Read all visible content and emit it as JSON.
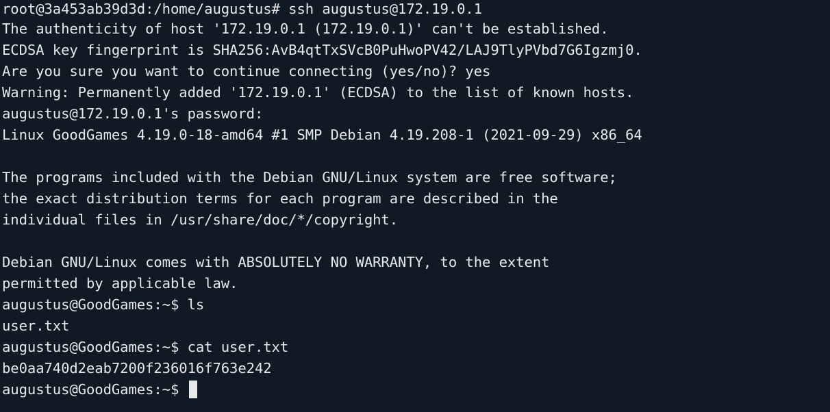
{
  "terminal": {
    "lines": [
      "root@3a453ab39d3d:/home/augustus# ssh augustus@172.19.0.1",
      "The authenticity of host '172.19.0.1 (172.19.0.1)' can't be established.",
      "ECDSA key fingerprint is SHA256:AvB4qtTxSVcB0PuHwoPV42/LAJ9TlyPVbd7G6Igzmj0.",
      "Are you sure you want to continue connecting (yes/no)? yes",
      "Warning: Permanently added '172.19.0.1' (ECDSA) to the list of known hosts.",
      "augustus@172.19.0.1's password:",
      "Linux GoodGames 4.19.0-18-amd64 #1 SMP Debian 4.19.208-1 (2021-09-29) x86_64",
      "",
      "The programs included with the Debian GNU/Linux system are free software;",
      "the exact distribution terms for each program are described in the",
      "individual files in /usr/share/doc/*/copyright.",
      "",
      "Debian GNU/Linux comes with ABSOLUTELY NO WARRANTY, to the extent",
      "permitted by applicable law.",
      "augustus@GoodGames:~$ ls",
      "user.txt",
      "augustus@GoodGames:~$ cat user.txt",
      "be0aa740d2eab7200f236016f763e242"
    ],
    "prompt": "augustus@GoodGames:~$ "
  },
  "colors": {
    "background": "#0f1a24",
    "foreground": "#e6e8ea"
  }
}
